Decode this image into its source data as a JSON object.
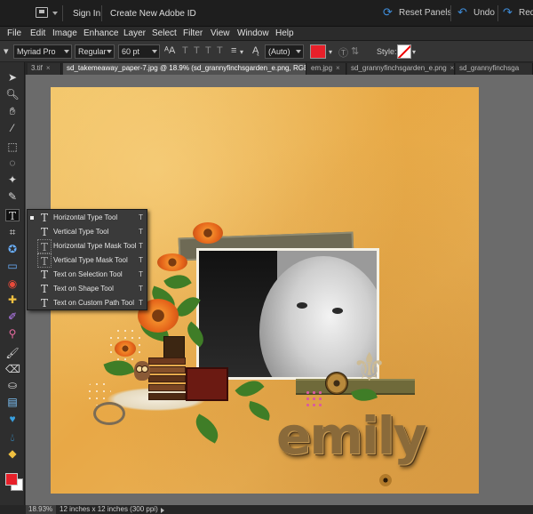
{
  "topbar": {
    "sign_in": "Sign In",
    "create_id": "Create New Adobe ID",
    "reset_panels": "Reset Panels",
    "undo": "Undo",
    "redo": "Red"
  },
  "menu": [
    "File",
    "Edit",
    "Image",
    "Enhance",
    "Layer",
    "Select",
    "Filter",
    "View",
    "Window",
    "Help"
  ],
  "options": {
    "font_family": "Myriad Pro",
    "font_style": "Regular",
    "font_size": "60 pt",
    "leading": "(Auto)",
    "style_label": "Style:",
    "text_color": "#e8202a"
  },
  "tabs": [
    {
      "label": "3.tif",
      "active": false
    },
    {
      "label": "sd_takemeaway_paper-7.jpg @ 18.9% (sd_grannyfinchsgarden_e.png, RGB/8) *",
      "active": true
    },
    {
      "label": "em.jpg",
      "active": false
    },
    {
      "label": "sd_grannyfinchsgarden_e.png",
      "active": false
    },
    {
      "label": "sd_grannyfinchsga",
      "active": false
    }
  ],
  "type_flyout": [
    {
      "label": "Horizontal Type Tool",
      "shortcut": "T",
      "selected": true
    },
    {
      "label": "Vertical Type Tool",
      "shortcut": "T",
      "selected": false
    },
    {
      "label": "Horizontal Type Mask Tool",
      "shortcut": "T",
      "selected": false
    },
    {
      "label": "Vertical Type Mask Tool",
      "shortcut": "T",
      "selected": false
    },
    {
      "label": "Text on Selection Tool",
      "shortcut": "T",
      "selected": false
    },
    {
      "label": "Text on Shape Tool",
      "shortcut": "T",
      "selected": false
    },
    {
      "label": "Text on Custom Path Tool",
      "shortcut": "T",
      "selected": false
    }
  ],
  "canvas": {
    "title_text": "emily"
  },
  "status": {
    "zoom": "18.93%",
    "doc_info": "12 inches x 12 inches (300 ppi)"
  },
  "colors": {
    "foreground": "#e8202a",
    "background": "#ffffff",
    "accent": "#3f8edc"
  }
}
